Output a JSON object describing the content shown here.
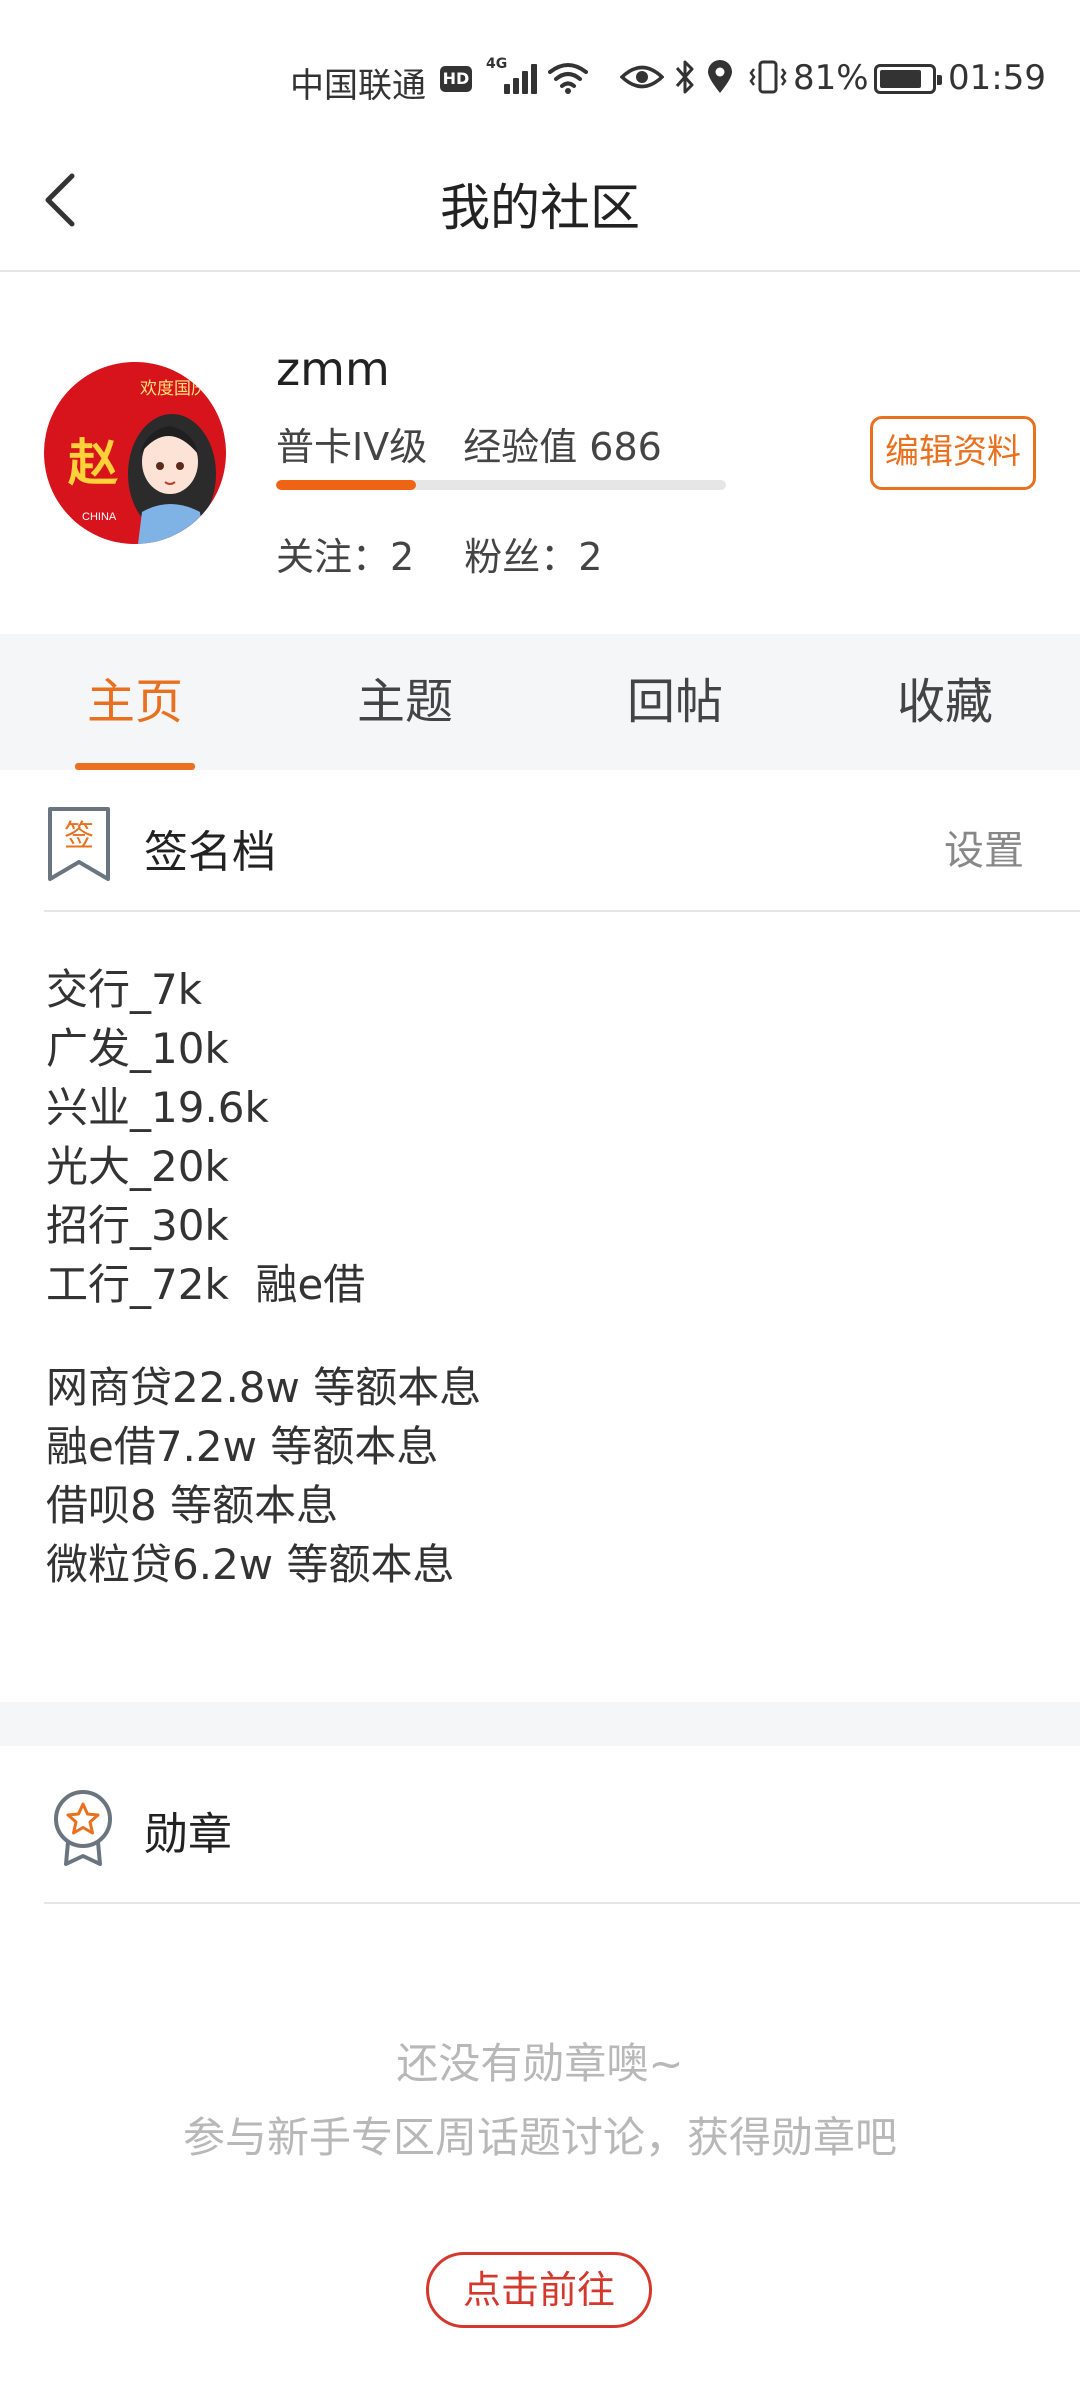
{
  "status_bar": {
    "carrier": "中国联通",
    "hd": "HD",
    "network": "4G",
    "battery_percent": "81%",
    "battery_level": 0.81,
    "time": "01:59"
  },
  "header": {
    "title": "我的社区",
    "back_icon": "chevron-left-icon"
  },
  "profile": {
    "username": "zmm",
    "level": "普卡IV级",
    "experience": "经验值 686",
    "experience_progress": 0.31,
    "following": "关注：2",
    "fans": "粉丝：2",
    "edit_button": "编辑资料",
    "avatar_text": "赵",
    "avatar_small": "CHINA",
    "avatar_banner": "欢度国庆"
  },
  "tabs": [
    {
      "label": "主页",
      "active": true
    },
    {
      "label": "主题",
      "active": false
    },
    {
      "label": "回帖",
      "active": false
    },
    {
      "label": "收藏",
      "active": false
    }
  ],
  "signature": {
    "icon_char": "签",
    "title": "签名档",
    "settings": "设置",
    "block1": [
      "交行_7k",
      "广发_10k",
      "兴业_19.6k",
      "光大_20k",
      "招行_30k",
      "工行_72k  融e借"
    ],
    "block2": [
      "网商贷22.8w 等额本息",
      "融e借7.2w 等额本息",
      "借呗8 等额本息",
      "微粒贷6.2w 等额本息"
    ]
  },
  "medals": {
    "title": "勋章",
    "empty_title": "还没有勋章噢~",
    "empty_desc": "参与新手专区周话题讨论，获得勋章吧",
    "go_button": "点击前往"
  },
  "colors": {
    "accent": "#e8701e",
    "go_button": "#d4382c",
    "tab_bg": "#f5f6f7"
  }
}
